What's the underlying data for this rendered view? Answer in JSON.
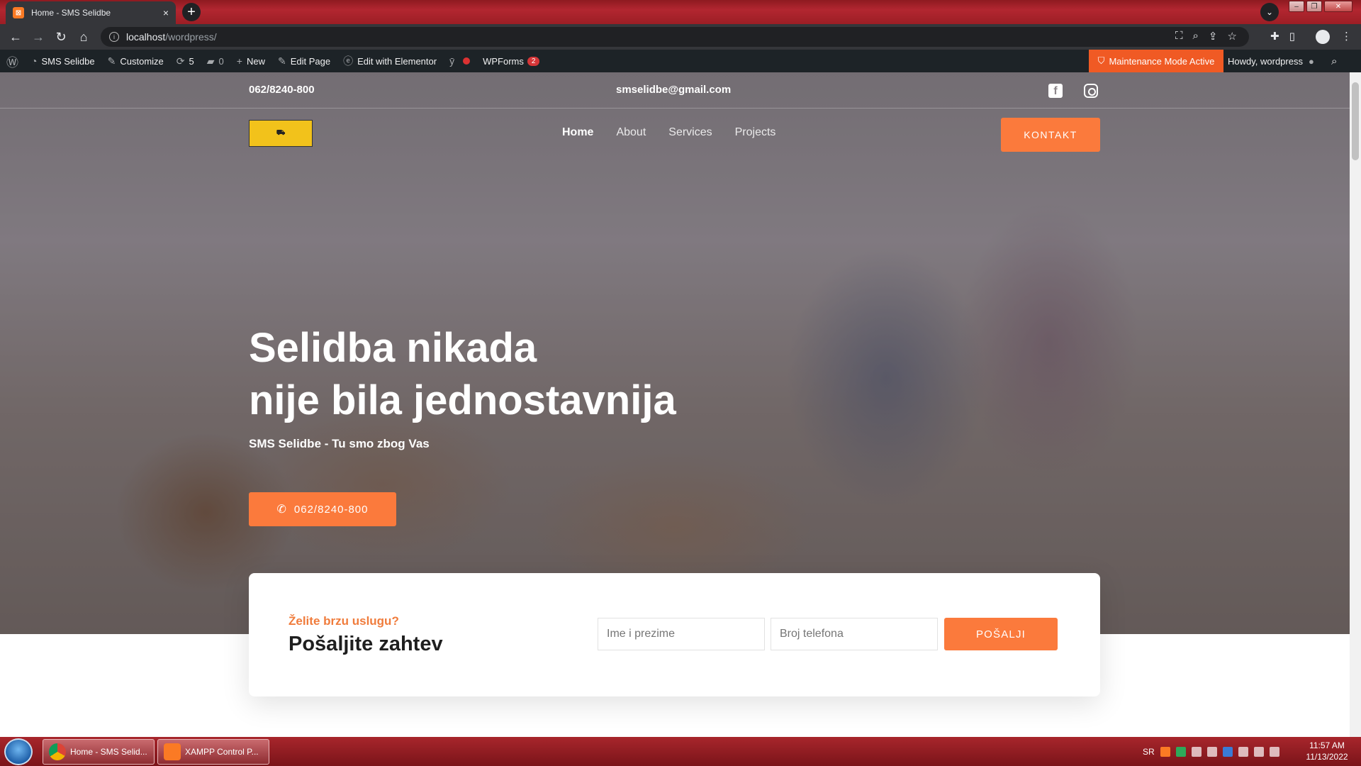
{
  "browser": {
    "tab_title": "Home - SMS Selidbe",
    "tab_close": "×",
    "new_tab": "+",
    "url_host": "localhost",
    "url_path": "/wordpress/"
  },
  "wpbar": {
    "site_name": "SMS Selidbe",
    "customize": "Customize",
    "updates_count": "5",
    "comments_count": "0",
    "new_label": "New",
    "edit_page": "Edit Page",
    "edit_elementor": "Edit with Elementor",
    "wpforms": "WPForms",
    "wpforms_badge": "2",
    "maintenance": "Maintenance Mode Active",
    "howdy": "Howdy, wordpress"
  },
  "site": {
    "top_phone": "062/8240-800",
    "top_email": "smselidbe@gmail.com",
    "nav": [
      "Home",
      "About",
      "Services",
      "Projects"
    ],
    "kontakt_button": "KONTAKT",
    "hero_title_line1": "Selidba nikada",
    "hero_title_line2": "nije bila jednostavnija",
    "hero_subtitle": "SMS Selidbe - Tu smo zbog Vas",
    "hero_call_button": "062/8240-800"
  },
  "request": {
    "eyebrow": "Želite brzu uslugu?",
    "title": "Pošaljite zahtev",
    "name_placeholder": "Ime i prezime",
    "phone_placeholder": "Broj telefona",
    "send_button": "POŠALJI"
  },
  "taskbar": {
    "item1": "Home - SMS Selid...",
    "item2": "XAMPP Control P...",
    "lang": "SR",
    "time": "11:57 AM",
    "date": "11/13/2022"
  },
  "colors": {
    "accent": "#fb7a3c",
    "admin_bar": "#1d2327",
    "maintenance": "#f05a24"
  }
}
